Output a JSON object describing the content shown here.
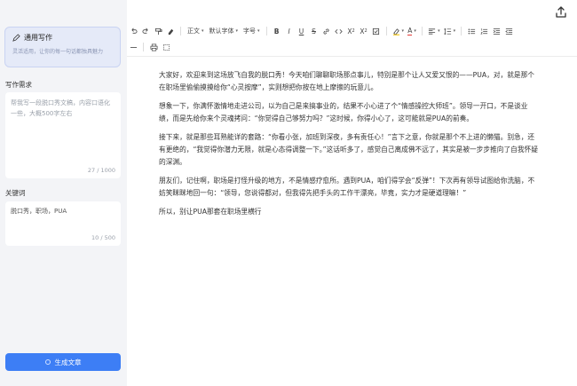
{
  "left_panel": {
    "mode_title": "通用写作",
    "mode_desc": "灵活适用，让你的每一句话都独具魅力",
    "requirement_label": "写作需求",
    "requirement_placeholder": "帮我写一段脱口秀文稿，内容口语化一些，大概500字左右",
    "requirement_count": "27 / 1000",
    "keywords_label": "关键词",
    "keywords_value": "脱口秀，职场，PUA",
    "keywords_count": "10 / 500",
    "generate_button": "生成文章"
  },
  "toolbar": {
    "paragraph_style": "正文",
    "font_family": "默认字体",
    "font_size": "字号"
  },
  "icons": [
    "back-arrow-icon",
    "share-icon",
    "undo-icon",
    "redo-icon",
    "format-painter-icon",
    "clear-format-icon",
    "bold-icon",
    "italic-icon",
    "underline-icon",
    "strikethrough-icon",
    "link-icon",
    "code-icon",
    "subscript-icon",
    "superscript-icon",
    "checkbox-icon",
    "highlight-icon",
    "font-color-icon",
    "align-icon",
    "line-height-icon",
    "bullet-list-icon",
    "ordered-list-icon",
    "indent-icon",
    "outdent-icon",
    "divider-icon",
    "print-icon",
    "select-all-icon"
  ],
  "document": {
    "paragraphs": [
      "大家好，欢迎来到这场放飞自我的脱口秀！今天咱们聊聊职场那点事儿，特别是那个让人又爱又恨的——PUA，对，就是那个在职场里偷偷摸摸给你“心灵按摩”，实则想把你按在地上摩擦的玩意儿。",
      "想象一下，你满怀激情地走进公司，以为自己是来搞事业的，结果不小心进了个“情感操控大师班”。领导一开口，不是谈业绩，而是先给你来个灵魂拷问：“你觉得自己够努力吗？”这时候，你得小心了，这可能就是PUA的前奏。",
      "接下来，就是那些耳熟能详的套路：“你看小张，加班到深夜，多有责任心！”言下之意，你就是那个不上进的懒猫。别急，还有更绝的，“我觉得你潜力无限，就是心态得调整一下。”这话听多了，感觉自己离成佛不远了，其实是被一步步推向了自我怀疑的深渊。",
      "朋友们，记住啊，职场是打怪升级的地方，不是情感疗愈所。遇到PUA，咱们得学会“反弹”！下次再有领导试图给你洗脑，不妨笑眯眯地回一句：“领导，您说得都对，但我得先把手头的工作干漂亮，毕竟，实力才是硬道理嘛！”",
      "所以，别让PUA那套在职场里横行"
    ]
  }
}
